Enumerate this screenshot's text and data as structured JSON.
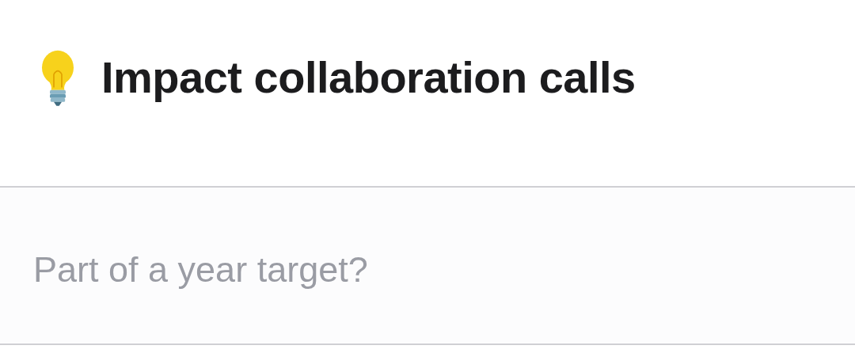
{
  "header": {
    "title": "Impact collaboration calls"
  },
  "field": {
    "placeholder": "Part of a year target?"
  }
}
